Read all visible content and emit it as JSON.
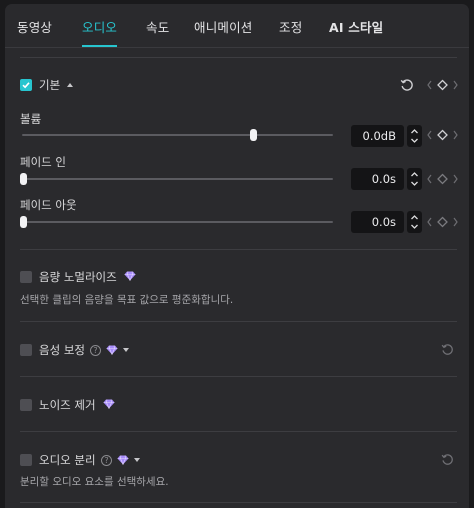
{
  "tabs": [
    {
      "label": "동영상",
      "active": false
    },
    {
      "label": "오디오",
      "active": true
    },
    {
      "label": "속도",
      "active": false
    },
    {
      "label": "애니메이션",
      "active": false
    },
    {
      "label": "조정",
      "active": false
    },
    {
      "label": "AI 스타일",
      "active": false
    }
  ],
  "colors": {
    "accent": "#27c5cf",
    "panel": "#2a2a2d",
    "field": "#141416",
    "premium_gem": "#a78bfa"
  },
  "basic": {
    "checked": true,
    "label": "기본",
    "expanded_icon": "caret-up-icon",
    "reset_icon": "reset-icon",
    "keyframe_icon": "keyframe-diamond-icon"
  },
  "controls": [
    {
      "label": "볼륨",
      "value": "0.0dB",
      "slider_fraction": 0.75
    },
    {
      "label": "페이드 인",
      "value": "0.0s",
      "slider_fraction": 0.0
    },
    {
      "label": "페이드 아웃",
      "value": "0.0s",
      "slider_fraction": 0.0
    }
  ],
  "sections": [
    {
      "label": "음량 노멀라이즈",
      "checked": false,
      "premium": true,
      "help": false,
      "dropdown": false,
      "reset": false,
      "description": "선택한 클립의 음량을 목표 값으로 평준화합니다."
    },
    {
      "label": "음성 보정",
      "checked": false,
      "premium": true,
      "help": true,
      "help_glyph": "?",
      "dropdown": true,
      "reset": true,
      "description": ""
    },
    {
      "label": "노이즈 제거",
      "checked": false,
      "premium": true,
      "help": false,
      "dropdown": false,
      "reset": false,
      "description": ""
    },
    {
      "label": "오디오 분리",
      "checked": false,
      "premium": true,
      "help": true,
      "help_glyph": "?",
      "dropdown": true,
      "reset": true,
      "description": "분리할 오디오 요소를 선택하세요."
    }
  ]
}
